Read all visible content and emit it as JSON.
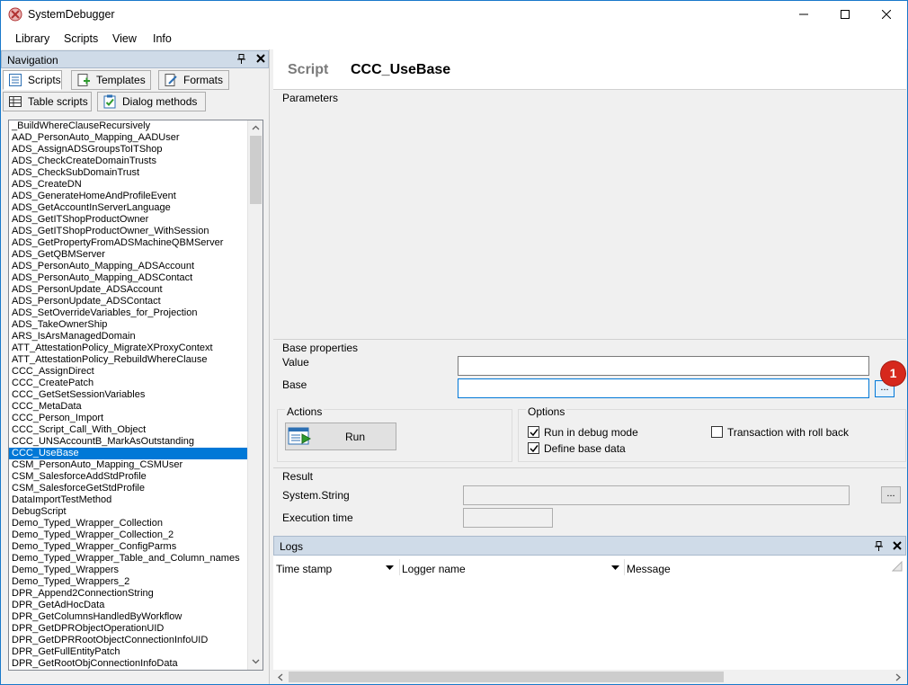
{
  "window": {
    "title": "SystemDebugger"
  },
  "menu": [
    "Library",
    "Scripts",
    "View",
    "Info"
  ],
  "navigation": {
    "title": "Navigation",
    "tabs": [
      {
        "label": "Scripts",
        "icon": "list-icon",
        "active": true
      },
      {
        "label": "Templates",
        "icon": "template-icon",
        "active": false
      },
      {
        "label": "Formats",
        "icon": "format-icon",
        "active": false
      },
      {
        "label": "Table scripts",
        "icon": "table-icon",
        "active": false
      },
      {
        "label": "Dialog methods",
        "icon": "checklist-icon",
        "active": false
      }
    ],
    "selected_item": "CCC_UseBase",
    "items": [
      "_BuildWhereClauseRecursively",
      "AAD_PersonAuto_Mapping_AADUser",
      "ADS_AssignADSGroupsToITShop",
      "ADS_CheckCreateDomainTrusts",
      "ADS_CheckSubDomainTrust",
      "ADS_CreateDN",
      "ADS_GenerateHomeAndProfileEvent",
      "ADS_GetAccountInServerLanguage",
      "ADS_GetITShopProductOwner",
      "ADS_GetITShopProductOwner_WithSession",
      "ADS_GetPropertyFromADSMachineQBMServer",
      "ADS_GetQBMServer",
      "ADS_PersonAuto_Mapping_ADSAccount",
      "ADS_PersonAuto_Mapping_ADSContact",
      "ADS_PersonUpdate_ADSAccount",
      "ADS_PersonUpdate_ADSContact",
      "ADS_SetOverrideVariables_for_Projection",
      "ADS_TakeOwnerShip",
      "ARS_IsArsManagedDomain",
      "ATT_AttestationPolicy_MigrateXProxyContext",
      "ATT_AttestationPolicy_RebuildWhereClause",
      "CCC_AssignDirect",
      "CCC_CreatePatch",
      "CCC_GetSetSessionVariables",
      "CCC_MetaData",
      "CCC_Person_Import",
      "CCC_Script_Call_With_Object",
      "CCC_UNSAccountB_MarkAsOutstanding",
      "CCC_UseBase",
      "CSM_PersonAuto_Mapping_CSMUser",
      "CSM_SalesforceAddStdProfile",
      "CSM_SalesforceGetStdProfile",
      "DataImportTestMethod",
      "DebugScript",
      "Demo_Typed_Wrapper_Collection",
      "Demo_Typed_Wrapper_Collection_2",
      "Demo_Typed_Wrapper_ConfigParms",
      "Demo_Typed_Wrapper_Table_and_Column_names",
      "Demo_Typed_Wrappers",
      "Demo_Typed_Wrappers_2",
      "DPR_Append2ConnectionString",
      "DPR_GetAdHocData",
      "DPR_GetColumnsHandledByWorkflow",
      "DPR_GetDPRObjectOperationUID",
      "DPR_GetDPRRootObjectConnectionInfoUID",
      "DPR_GetFullEntityPatch",
      "DPR_GetRootObjConnectionInfoData"
    ]
  },
  "script": {
    "label": "Script",
    "name": "CCC_UseBase"
  },
  "parameters": {
    "title": "Parameters"
  },
  "base_properties": {
    "title": "Base properties",
    "value_label": "Value",
    "value": "",
    "base_label": "Base",
    "base": "",
    "browse_label": "..."
  },
  "callout": {
    "number": "1",
    "color": "#d6281c"
  },
  "actions": {
    "title": "Actions",
    "run_label": "Run"
  },
  "options": {
    "title": "Options",
    "run_in_debug_mode": {
      "label": "Run in debug mode",
      "checked": true
    },
    "define_base_data": {
      "label": "Define base data",
      "checked": true
    },
    "transaction_with_roll_back": {
      "label": "Transaction with roll back",
      "checked": false
    }
  },
  "result": {
    "title": "Result",
    "type_label": "System.String",
    "value": "",
    "browse_label": "...",
    "execution_time_label": "Execution time",
    "execution_time": ""
  },
  "logs": {
    "title": "Logs",
    "columns": [
      "Time stamp",
      "Logger name",
      "Message"
    ]
  },
  "colors": {
    "accent": "#0078d7",
    "panel_header": "#cfdbe8",
    "window_border": "#1979ca"
  }
}
